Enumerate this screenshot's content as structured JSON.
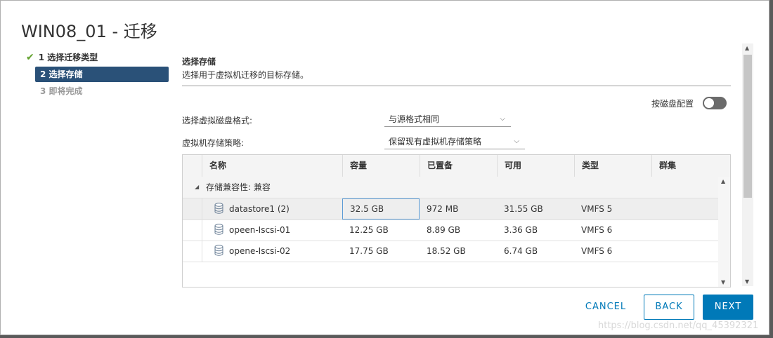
{
  "dialog": {
    "title": "WIN08_01 - 迁移"
  },
  "steps": [
    {
      "label": "1 选择迁移类型",
      "state": "done"
    },
    {
      "label": "2 选择存储",
      "state": "active"
    },
    {
      "label": "3 即将完成",
      "state": "pending"
    }
  ],
  "section": {
    "title": "选择存储",
    "description": "选择用于虚拟机迁移的目标存储。"
  },
  "disk_config": {
    "label": "按磁盘配置",
    "enabled": false
  },
  "form": {
    "disk_format_label": "选择虚拟磁盘格式:",
    "disk_format_value": "与源格式相同",
    "storage_policy_label": "虚拟机存储策略:",
    "storage_policy_value": "保留现有虚拟机存储策略"
  },
  "table": {
    "columns": [
      "名称",
      "容量",
      "已置备",
      "可用",
      "类型",
      "群集"
    ],
    "group_label": "存储兼容性: 兼容",
    "rows": [
      {
        "name": "datastore1 (2)",
        "capacity": "32.5 GB",
        "provisioned": "972 MB",
        "free": "31.55 GB",
        "type": "VMFS 5",
        "cluster": ""
      },
      {
        "name": "opeen-Iscsi-01",
        "capacity": "12.25 GB",
        "provisioned": "8.89 GB",
        "free": "3.36 GB",
        "type": "VMFS 6",
        "cluster": ""
      },
      {
        "name": "opene-Iscsi-02",
        "capacity": "17.75 GB",
        "provisioned": "18.52 GB",
        "free": "6.74 GB",
        "type": "VMFS 6",
        "cluster": ""
      }
    ]
  },
  "buttons": {
    "cancel": "CANCEL",
    "back": "BACK",
    "next": "NEXT"
  },
  "watermark": "https://blog.csdn.net/qq_45392321",
  "colors": {
    "accent": "#0079b8",
    "active_step": "#2a5178",
    "check": "#5fa02a"
  }
}
